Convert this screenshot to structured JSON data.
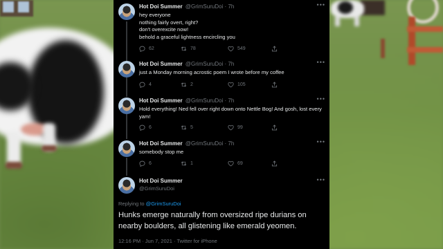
{
  "tweets": [
    {
      "name": "Hot Doi Summer",
      "handle": "@GrimSuruDoi · 7h",
      "text": "hey everyone\nnothing fairly overt, right?\ndon't overexcite now!\nbehold a graceful lightness encircling you",
      "replies": "62",
      "retweets": "78",
      "likes": "549"
    },
    {
      "name": "Hot Doi Summer",
      "handle": "@GrimSuruDoi · 7h",
      "text": "just a Monday morning acrostic poem I wrote before my coffee",
      "replies": "4",
      "retweets": "2",
      "likes": "105"
    },
    {
      "name": "Hot Doi Summer",
      "handle": "@GrimSuruDoi · 7h",
      "text": "Hold everything! Ned fell over right down onto Nettle Bog! And gosh, lost every yam!",
      "replies": "6",
      "retweets": "5",
      "likes": "99"
    },
    {
      "name": "Hot Doi Summer",
      "handle": "@GrimSuruDoi · 7h",
      "text": "somebody stop me",
      "replies": "6",
      "retweets": "1",
      "likes": "69"
    }
  ],
  "focus": {
    "name": "Hot Doi Summer",
    "handle": "@GrimSuruDoi",
    "replying_prefix": "Replying to ",
    "replying_mention": "@GrimSuruDoi",
    "text": "Hunks emerge naturally from oversized ripe durians on nearby boulders, all glistening like emerald yeomen.",
    "meta": "12:16 PM · Jun 7, 2021 · Twitter for iPhone"
  },
  "icons": {
    "more": "more-dots-icon",
    "reply": "reply-bubble-icon",
    "retweet": "retweet-arrows-icon",
    "like": "heart-icon",
    "share": "share-upload-icon"
  },
  "colors": {
    "background": "#000000",
    "text": "#e7e9ea",
    "secondary": "#71767b",
    "mention": "#1d9bf0"
  }
}
